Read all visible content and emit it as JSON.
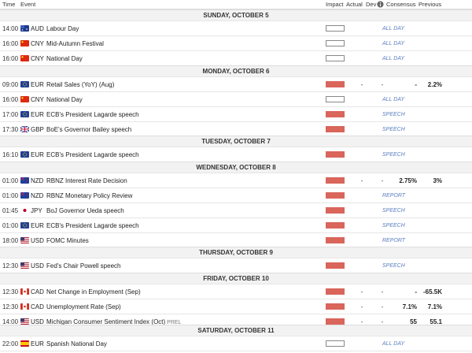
{
  "header": {
    "time": "Time",
    "event": "Event",
    "impact": "Impact",
    "actual": "Actual",
    "dev": "Dev",
    "info_icon": "info-icon",
    "consensus": "Consensus",
    "previous": "Previous"
  },
  "days": [
    {
      "label": "SUNDAY, OCTOBER 5",
      "events": [
        {
          "time": "14:00",
          "flag": "au",
          "currency": "AUD",
          "name": "Labour Day",
          "impact": "low",
          "tag": "ALL DAY"
        },
        {
          "time": "16:00",
          "flag": "cn",
          "currency": "CNY",
          "name": "Mid-Autumn Festival",
          "impact": "low",
          "tag": "ALL DAY"
        },
        {
          "time": "16:00",
          "flag": "cn",
          "currency": "CNY",
          "name": "National Day",
          "impact": "low",
          "tag": "ALL DAY"
        }
      ]
    },
    {
      "label": "MONDAY, OCTOBER 6",
      "events": [
        {
          "time": "09:00",
          "flag": "eu",
          "currency": "EUR",
          "name": "Retail Sales (YoY) (Aug)",
          "impact": "high",
          "actual": "-",
          "dev": "-",
          "consensus": "-",
          "previous": "2.2%"
        },
        {
          "time": "16:00",
          "flag": "cn",
          "currency": "CNY",
          "name": "National Day",
          "impact": "low",
          "tag": "ALL DAY"
        },
        {
          "time": "17:00",
          "flag": "eu",
          "currency": "EUR",
          "name": "ECB's President Lagarde speech",
          "impact": "high",
          "tag": "SPEECH"
        },
        {
          "time": "17:30",
          "flag": "gb",
          "currency": "GBP",
          "name": "BoE's Governor Bailey speech",
          "impact": "high",
          "tag": "SPEECH"
        }
      ]
    },
    {
      "label": "TUESDAY, OCTOBER 7",
      "events": [
        {
          "time": "16:10",
          "flag": "eu",
          "currency": "EUR",
          "name": "ECB's President Lagarde speech",
          "impact": "high",
          "tag": "SPEECH"
        }
      ]
    },
    {
      "label": "WEDNESDAY, OCTOBER 8",
      "events": [
        {
          "time": "01:00",
          "flag": "nz",
          "currency": "NZD",
          "name": "RBNZ Interest Rate Decision",
          "impact": "high",
          "actual": "-",
          "dev": "-",
          "consensus": "2.75%",
          "previous": "3%"
        },
        {
          "time": "01:00",
          "flag": "nz",
          "currency": "NZD",
          "name": "RBNZ Monetary Policy Review",
          "impact": "high",
          "tag": "REPORT"
        },
        {
          "time": "01:45",
          "flag": "jp",
          "currency": "JPY",
          "name": "BoJ Governor Ueda speech",
          "impact": "high",
          "tag": "SPEECH"
        },
        {
          "time": "01:00",
          "flag": "eu",
          "currency": "EUR",
          "name": "ECB's President Lagarde speech",
          "impact": "high",
          "tag": "SPEECH"
        },
        {
          "time": "18:00",
          "flag": "us",
          "currency": "USD",
          "name": "FOMC Minutes",
          "impact": "high",
          "tag": "REPORT"
        }
      ]
    },
    {
      "label": "THURSDAY, OCTOBER 9",
      "events": [
        {
          "time": "12:30",
          "flag": "us",
          "currency": "USD",
          "name": "Fed's Chair Powell speech",
          "impact": "high",
          "tag": "SPEECH"
        }
      ]
    },
    {
      "label": "FRIDAY, OCTOBER 10",
      "events": [
        {
          "time": "12:30",
          "flag": "ca",
          "currency": "CAD",
          "name": "Net Change in Employment (Sep)",
          "impact": "high",
          "actual": "-",
          "dev": "-",
          "consensus": "-",
          "previous": "-65.5K"
        },
        {
          "time": "12:30",
          "flag": "ca",
          "currency": "CAD",
          "name": "Unemployment Rate (Sep)",
          "impact": "high",
          "actual": "-",
          "dev": "-",
          "consensus": "7.1%",
          "previous": "7.1%"
        },
        {
          "time": "14:00",
          "flag": "us",
          "currency": "USD",
          "name": "Michigan Consumer Sentiment Index (Oct)",
          "prel": "PREL",
          "impact": "high",
          "actual": "-",
          "dev": "-",
          "consensus": "55",
          "previous": "55.1"
        }
      ]
    },
    {
      "label": "SATURDAY, OCTOBER 11",
      "events": [
        {
          "time": "22:00",
          "flag": "es",
          "currency": "EUR",
          "name": "Spanish National Day",
          "impact": "low",
          "tag": "ALL DAY"
        }
      ]
    }
  ]
}
